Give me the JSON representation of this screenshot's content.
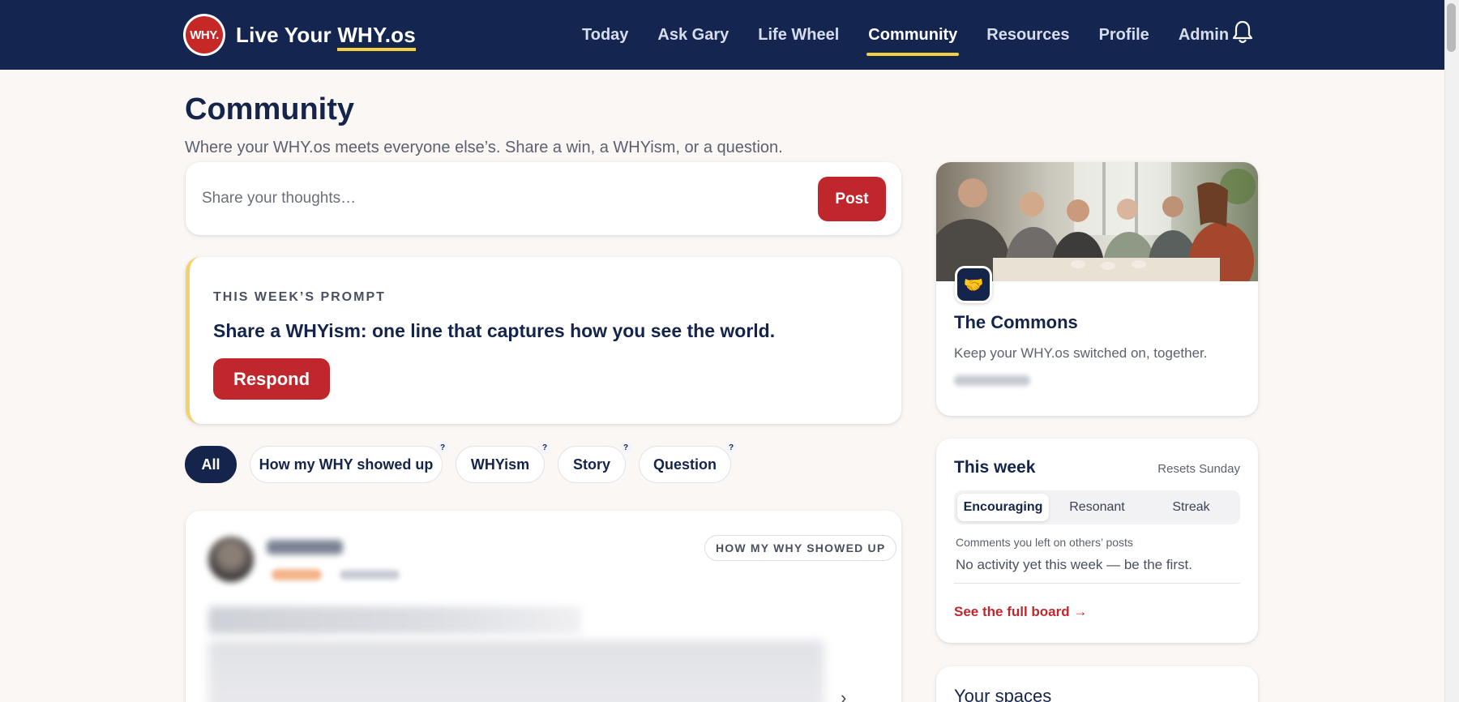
{
  "nav": {
    "brand_logo": "WHY.",
    "brand_prefix": "Live Your",
    "brand_emph": "WHY.os",
    "items": [
      {
        "label": "Today"
      },
      {
        "label": "Ask Gary"
      },
      {
        "label": "Life Wheel"
      },
      {
        "label": "Community",
        "active": true
      },
      {
        "label": "Resources"
      },
      {
        "label": "Profile"
      },
      {
        "label": "Admin"
      }
    ],
    "bell_icon": "bell-icon"
  },
  "header": {
    "title": "Community",
    "subtitle": "Where your WHY.os meets everyone else’s. Share a win, a WHYism, or a question."
  },
  "composer": {
    "placeholder": "Share your thoughts…",
    "post_label": "Post"
  },
  "prompt": {
    "label": "THIS WEEK’S PROMPT",
    "text": "Share a WHYism: one line that captures how you see the world.",
    "respond_label": "Respond"
  },
  "filters": [
    {
      "label": "All",
      "active": true
    },
    {
      "label": "How my WHY showed up",
      "help": "?"
    },
    {
      "label": "WHYism",
      "help": "?"
    },
    {
      "label": "Story",
      "help": "?"
    },
    {
      "label": "Question",
      "help": "?"
    }
  ],
  "post": {
    "tag": "HOW MY WHY SHOWED UP",
    "chevron": "›"
  },
  "commons": {
    "badge_icon": "🤝",
    "title": "The Commons",
    "description": "Keep your WHY.os switched on, together."
  },
  "week": {
    "title": "This week",
    "reset": "Resets Sunday",
    "tabs": [
      {
        "label": "Encouraging",
        "active": true
      },
      {
        "label": "Resonant"
      },
      {
        "label": "Streak"
      }
    ],
    "caption": "Comments you left on others’ posts",
    "empty": "No activity yet this week — be the first.",
    "link": "See the full board →"
  },
  "spaces": {
    "title": "Your spaces"
  },
  "colors": {
    "navy": "#142650",
    "accent_red": "#c0272d",
    "accent_yellow": "#f5d142",
    "background": "#faf7f4"
  }
}
